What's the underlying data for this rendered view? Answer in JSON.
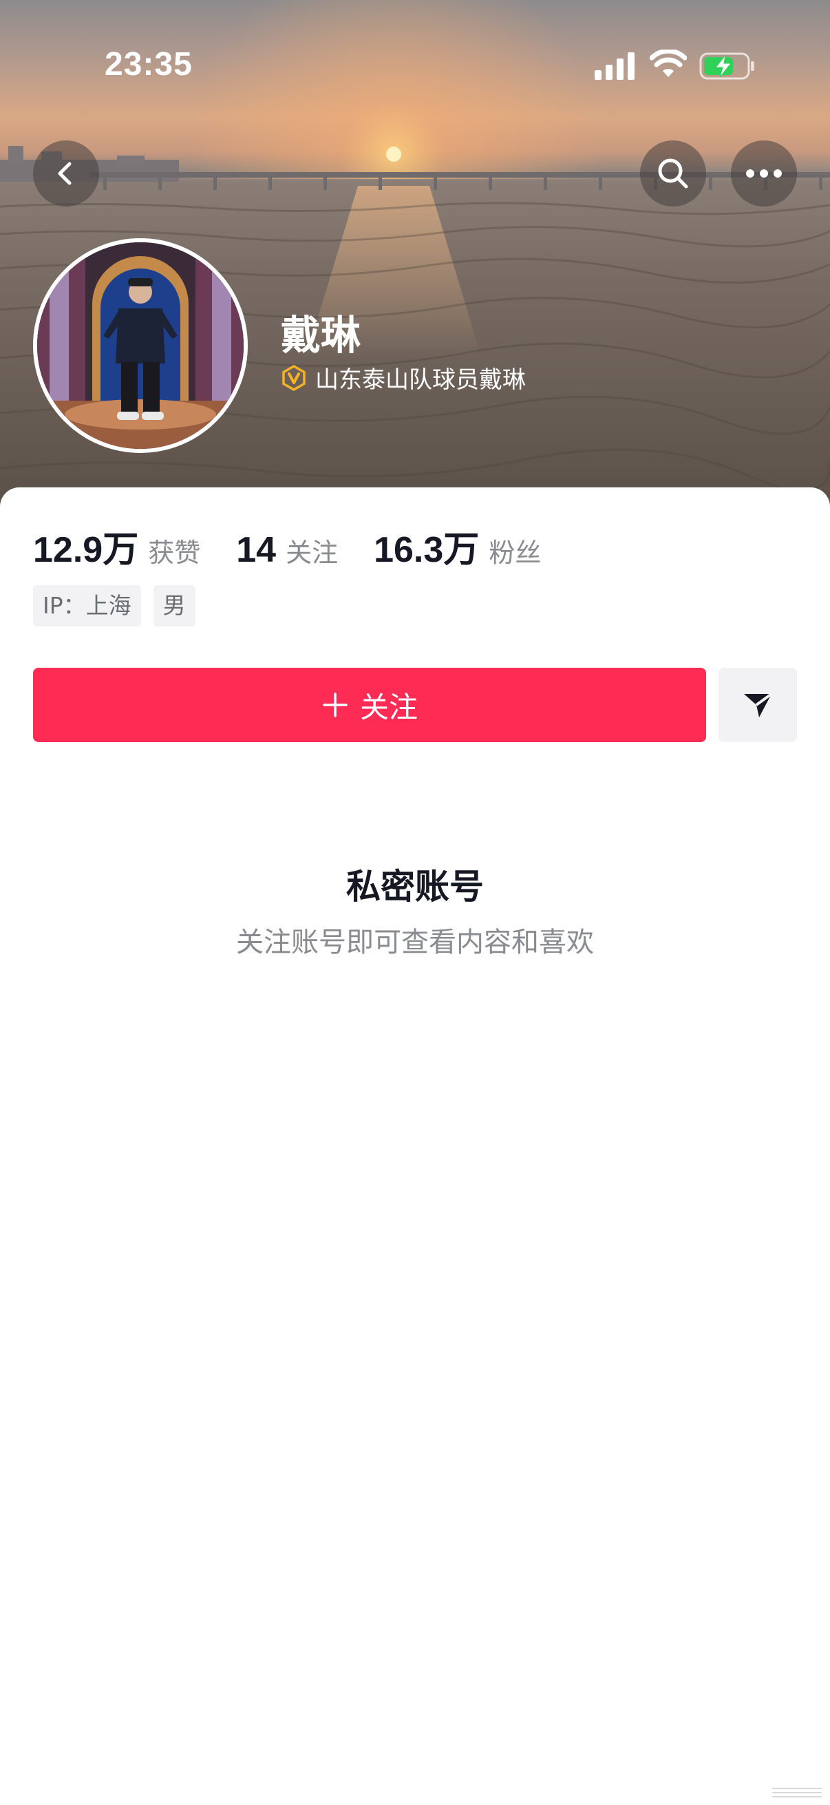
{
  "status_bar": {
    "time": "23:35",
    "signal_icon": "cellular-signal-icon",
    "wifi_icon": "wifi-icon",
    "battery_icon": "battery-charging-icon",
    "battery_color": "#30d158"
  },
  "nav": {
    "back_icon": "chevron-left-icon",
    "search_icon": "search-icon",
    "more_icon": "more-dots-icon"
  },
  "profile": {
    "name": "戴琳",
    "verified_icon": "verified-v-badge-icon",
    "verified_color": "#f5b128",
    "verified_text": "山东泰山队球员戴琳"
  },
  "stats": [
    {
      "value": "12.9万",
      "label": "获赞"
    },
    {
      "value": "14",
      "label": "关注"
    },
    {
      "value": "16.3万",
      "label": "粉丝"
    }
  ],
  "tags": [
    "IP：上海",
    "男"
  ],
  "actions": {
    "follow_icon": "plus-icon",
    "follow_label": "关注",
    "follow_color": "#fe2c55",
    "share_icon": "send-paper-plane-icon"
  },
  "private_notice": {
    "title": "私密账号",
    "subtitle": "关注账号即可查看内容和喜欢"
  }
}
